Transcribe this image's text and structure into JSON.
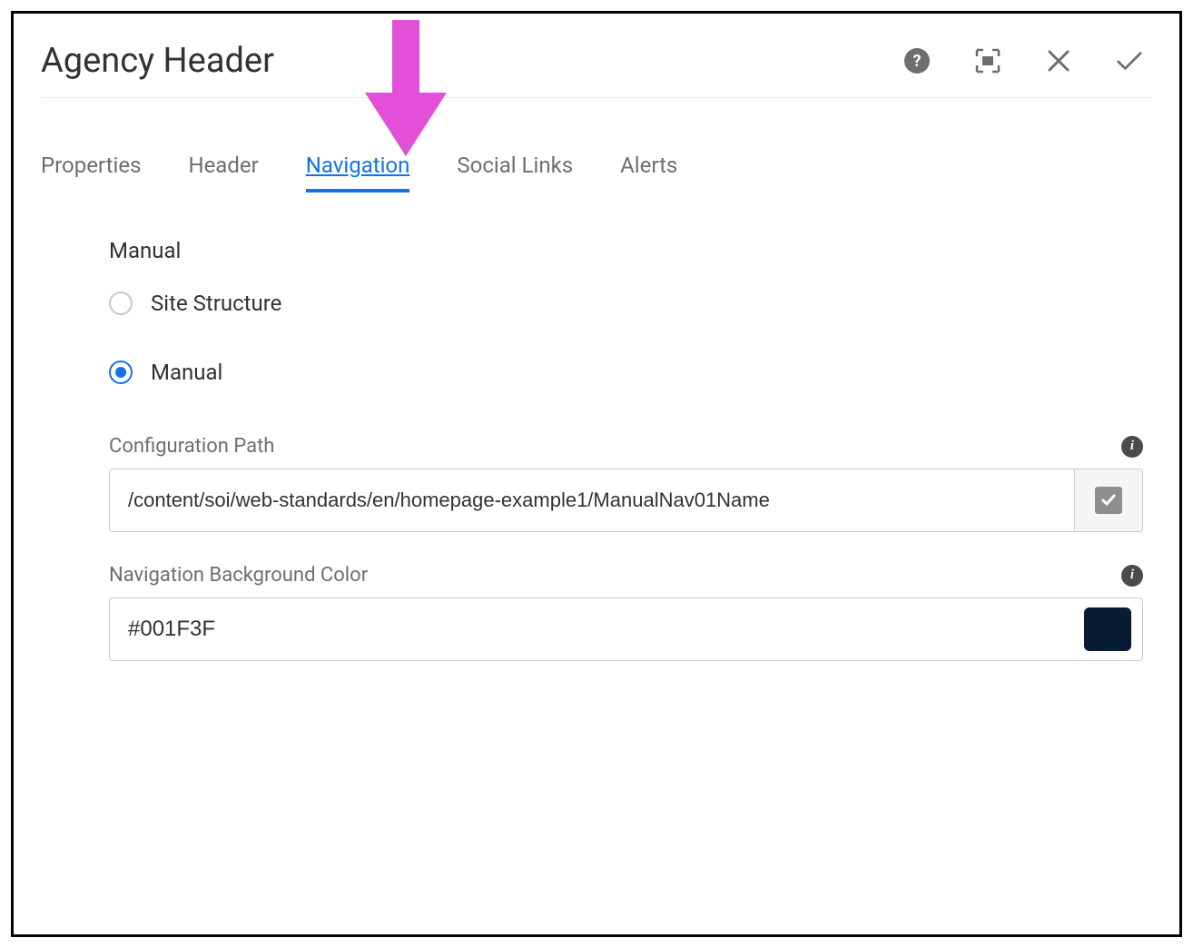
{
  "dialog": {
    "title": "Agency Header"
  },
  "tabs": [
    {
      "label": "Properties",
      "active": false
    },
    {
      "label": "Header",
      "active": false
    },
    {
      "label": "Navigation",
      "active": true
    },
    {
      "label": "Social Links",
      "active": false
    },
    {
      "label": "Alerts",
      "active": false
    }
  ],
  "navigation": {
    "section_label": "Manual",
    "radio_options": [
      {
        "label": "Site Structure",
        "selected": false
      },
      {
        "label": "Manual",
        "selected": true
      }
    ],
    "config_path": {
      "label": "Configuration Path",
      "value": "/content/soi/web-standards/en/homepage-example1/ManualNav01Name"
    },
    "bg_color": {
      "label": "Navigation Background Color",
      "value": "#001F3F",
      "swatch": "#071b33"
    }
  },
  "annotation": {
    "arrow_color": "#e24fd8"
  }
}
